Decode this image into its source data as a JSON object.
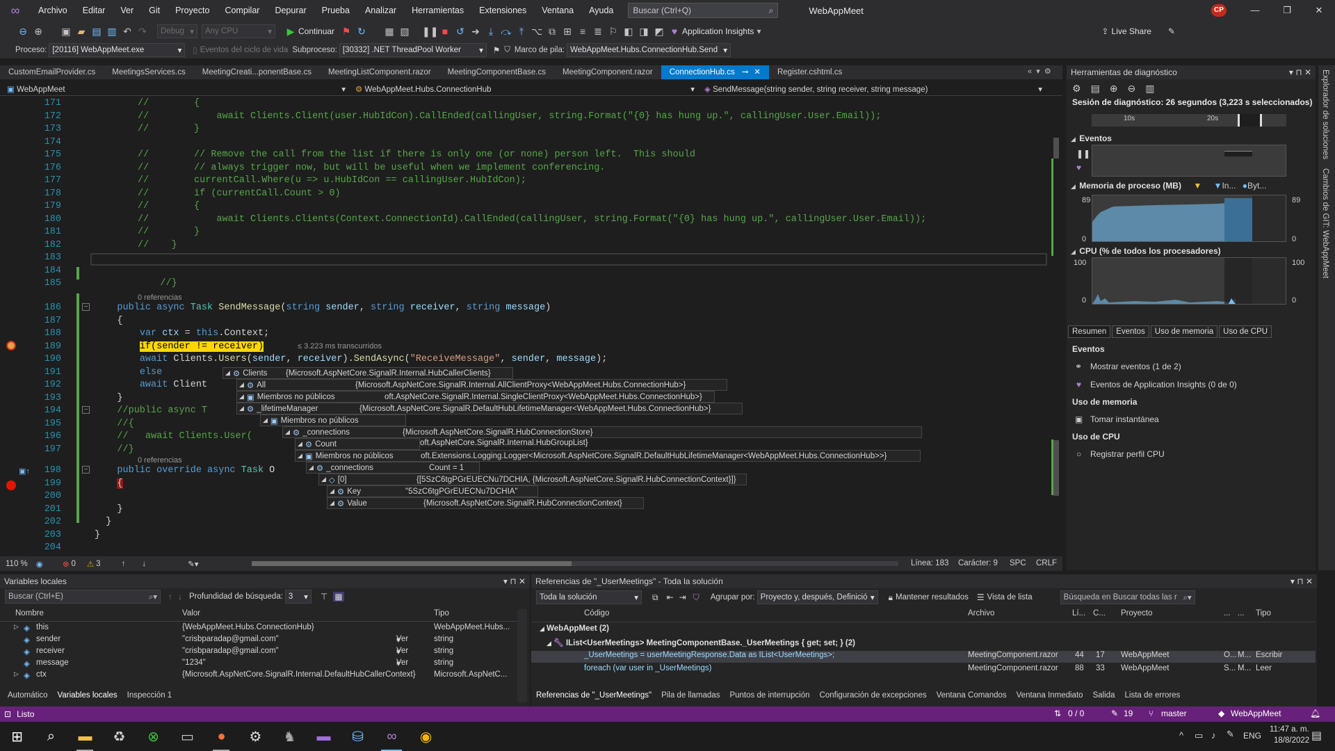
{
  "app": {
    "title": "WebAppMeet",
    "avatar": "CP",
    "menu": [
      "Archivo",
      "Editar",
      "Ver",
      "Git",
      "Proyecto",
      "Compilar",
      "Depurar",
      "Prueba",
      "Analizar",
      "Herramientas",
      "Extensiones",
      "Ventana",
      "Ayuda"
    ],
    "search_placeholder": "Buscar (Ctrl+Q)"
  },
  "toolbar": {
    "config": "Debug",
    "platform": "Any CPU",
    "continue_label": "Continuar",
    "insights_label": "Application Insights",
    "live_share": "Live Share"
  },
  "process_bar": {
    "process_label": "Proceso:",
    "process_value": "[20116] WebAppMeet.exe",
    "lifecycle": "Eventos del ciclo de vida",
    "thread_label": "Subproceso:",
    "thread_value": "[30332] .NET ThreadPool Worker",
    "frame_label": "Marco de pila:",
    "frame_value": "WebAppMeet.Hubs.ConnectionHub.Send"
  },
  "tabs": [
    "CustomEmailProvider.cs",
    "MeetingsServices.cs",
    "MeetingCreati...ponentBase.cs",
    "MeetingListComponent.razor",
    "MeetingComponentBase.cs",
    "MeetingComponent.razor",
    "ConnectionHub.cs",
    "Register.cshtml.cs"
  ],
  "active_tab": "ConnectionHub.cs",
  "navbar": {
    "project": "WebAppMeet",
    "class": "WebAppMeet.Hubs.ConnectionHub",
    "member": "SendMessage(string sender, string receiver, string message)"
  },
  "code": [
    {
      "n": "171",
      "t": "//        {"
    },
    {
      "n": "172",
      "t": "//            await Clients.Client(user.HubIdCon).CallEnded(callingUser, string.Format(\"{0} has hung up.\", callingUser.User.Email));"
    },
    {
      "n": "173",
      "t": "//        }"
    },
    {
      "n": "174",
      "t": ""
    },
    {
      "n": "175",
      "t": "//        // Remove the call from the list if there is only one (or none) person left.  This should"
    },
    {
      "n": "176",
      "t": "//        // always trigger now, but will be useful when we implement conferencing."
    },
    {
      "n": "177",
      "t": "//        currentCall.Where(u => u.HubIdCon == callingUser.HubIdCon);"
    },
    {
      "n": "178",
      "t": "//        if (currentCall.Count > 0)"
    },
    {
      "n": "179",
      "t": "//        {"
    },
    {
      "n": "180",
      "t": "//            await Clients.Clients(Context.ConnectionId).CallEnded(callingUser, string.Format(\"{0} has hung up.\", callingUser.User.Email));"
    },
    {
      "n": "181",
      "t": "//        }"
    },
    {
      "n": "182",
      "t": "//    }"
    },
    {
      "n": "183",
      "t": ""
    },
    {
      "n": "184",
      "t": ""
    },
    {
      "n": "185",
      "t": "    //}"
    }
  ],
  "code2": {
    "refs": "0 referencias",
    "l186": "186",
    "l187": "187",
    "l188": "188",
    "l189": "189",
    "l190": "190",
    "l191": "191",
    "l192": "192",
    "l193": "193",
    "l194": "194",
    "l195": "195",
    "l196": "196",
    "l197": "197",
    "l198": "198",
    "l199": "199",
    "l200": "200",
    "l201": "201",
    "l202": "202",
    "l203": "203",
    "l204": "204",
    "elapsed": "≤ 3.223 ms transcurridos"
  },
  "datatips": [
    {
      "name": "Clients",
      "value": "{Microsoft.AspNetCore.SignalR.Internal.HubCallerClients}"
    },
    {
      "name": "All",
      "value": "{Microsoft.AspNetCore.SignalR.Internal.AllClientProxy<WebAppMeet.Hubs.ConnectionHub>}"
    },
    {
      "name": "Miembros no públicos",
      "value": "oft.AspNetCore.SignalR.Internal.SingleClientProxy<WebAppMeet.Hubs.ConnectionHub>}"
    },
    {
      "name": "_lifetimeManager",
      "value": "{Microsoft.AspNetCore.SignalR.DefaultHubLifetimeManager<WebAppMeet.Hubs.ConnectionHub>}"
    },
    {
      "name": "Miembros no públicos",
      "value": ""
    },
    {
      "name": "_connections",
      "value": "{Microsoft.AspNetCore.SignalR.HubConnectionStore}"
    },
    {
      "name": "Count",
      "value": "1"
    },
    {
      "name": "Miembros no públicos",
      "value": "oft.Extensions.Logging.Logger<Microsoft.AspNetCore.SignalR.DefaultHubLifetimeManager<WebAppMeet.Hubs.ConnectionHub>>}"
    },
    {
      "name": "_connections",
      "value": "Count = 1"
    },
    {
      "name": "[0]",
      "value": "{[5SzC6tgPGrEUECNu7DCHIA, {Microsoft.AspNetCore.SignalR.HubConnectionContext}]}"
    },
    {
      "name": "Key",
      "value": "\"5SzC6tgPGrEUECNu7DCHIA\""
    },
    {
      "name": "Value",
      "value": "{Microsoft.AspNetCore.SignalR.HubConnectionContext}"
    }
  ],
  "datatip_extra": {
    "v1": "oft.AspNetCore.SignalR.Internal.HubGroupList}",
    "ver": "Ver"
  },
  "editor_status": {
    "zoom": "110 %",
    "errors": "0",
    "warnings": "3",
    "line": "Línea: 183",
    "char": "Carácter: 9",
    "spc": "SPC",
    "crlf": "CRLF"
  },
  "diagnostics": {
    "title": "Herramientas de diagnóstico",
    "session": "Sesión de diagnóstico: 26 segundos (3,223 s seleccionados)",
    "tick10": "10s",
    "tick20": "20s",
    "events_label": "Eventos",
    "memory_label": "Memoria de proceso (MB)",
    "memory_legend1": "In...",
    "memory_legend2": "Byt...",
    "mem_max": "89",
    "mem_min": "0",
    "cpu_label": "CPU (% de todos los procesadores)",
    "cpu_max": "100",
    "cpu_min": "0",
    "tabs": [
      "Resumen",
      "Eventos",
      "Uso de memoria",
      "Uso de CPU"
    ],
    "sec_events": "Eventos",
    "show_events": "Mostrar eventos (1 de 2)",
    "ai_events": "Eventos de Application Insights (0 de 0)",
    "sec_memory": "Uso de memoria",
    "snapshot": "Tomar instantánea",
    "sec_cpu": "Uso de CPU",
    "cpu_profile": "Registrar perfil CPU"
  },
  "right_sidebar": [
    "Explorador de soluciones",
    "Cambios de GIT: WebAppMeet"
  ],
  "locals": {
    "title": "Variables locales",
    "search": "Buscar (Ctrl+E)",
    "depth_label": "Profundidad de búsqueda:",
    "depth": "3",
    "headers": [
      "Nombre",
      "Valor",
      "Tipo"
    ],
    "rows": [
      {
        "name": "this",
        "value": "{WebAppMeet.Hubs.ConnectionHub}",
        "type": "WebAppMeet.Hubs..."
      },
      {
        "name": "sender",
        "value": "\"crisbparadap@gmail.com\"",
        "type": "string"
      },
      {
        "name": "receiver",
        "value": "\"crisbparadap@gmail.com\"",
        "type": "string"
      },
      {
        "name": "message",
        "value": "\"1234\"",
        "type": "string"
      },
      {
        "name": "ctx",
        "value": "{Microsoft.AspNetCore.SignalR.Internal.DefaultHubCallerContext}",
        "type": "Microsoft.AspNetC..."
      }
    ],
    "ver": "Ver",
    "tabs": [
      "Automático",
      "Variables locales",
      "Inspección 1"
    ]
  },
  "refs": {
    "title": "Referencias de \"_UserMeetings\" - Toda la solución",
    "scope": "Toda la solución",
    "group_label": "Agrupar por:",
    "group_value": "Proyecto y, después, Definició",
    "keep": "Mantener resultados",
    "listview": "Vista de lista",
    "search": "Búsqueda en Buscar todas las r",
    "headers": [
      "Código",
      "Archivo",
      "Lí...",
      "C...",
      "Proyecto",
      "...",
      "...",
      "Tipo"
    ],
    "group": "WebAppMeet (2)",
    "def": "IList<UserMeetings> MeetingComponentBase._UserMeetings { get; set; } (2)",
    "rows": [
      {
        "code": "_UserMeetings = userMeetingResponse.Data as IList<UserMeetings>;",
        "file": "MeetingComponent.razor",
        "line": "44",
        "col": "17",
        "project": "WebAppMeet",
        "a": "O...",
        "b": "M...",
        "kind": "Escribir"
      },
      {
        "code": "foreach (var user in _UserMeetings)",
        "file": "MeetingComponent.razor",
        "line": "88",
        "col": "33",
        "project": "WebAppMeet",
        "a": "S...",
        "b": "M...",
        "kind": "Leer"
      }
    ],
    "tabs": [
      "Referencias de \"_UserMeetings\"",
      "Pila de llamadas",
      "Puntos de interrupción",
      "Configuración de excepciones",
      "Ventana Comandos",
      "Ventana Inmediato",
      "Salida",
      "Lista de errores"
    ]
  },
  "statusbar": {
    "ready": "Listo",
    "changes": "0 / 0",
    "edits": "19",
    "branch": "master",
    "repo": "WebAppMeet"
  },
  "taskbar": {
    "lang": "ENG",
    "time": "11:47 a. m.",
    "date": "18/8/2022"
  }
}
